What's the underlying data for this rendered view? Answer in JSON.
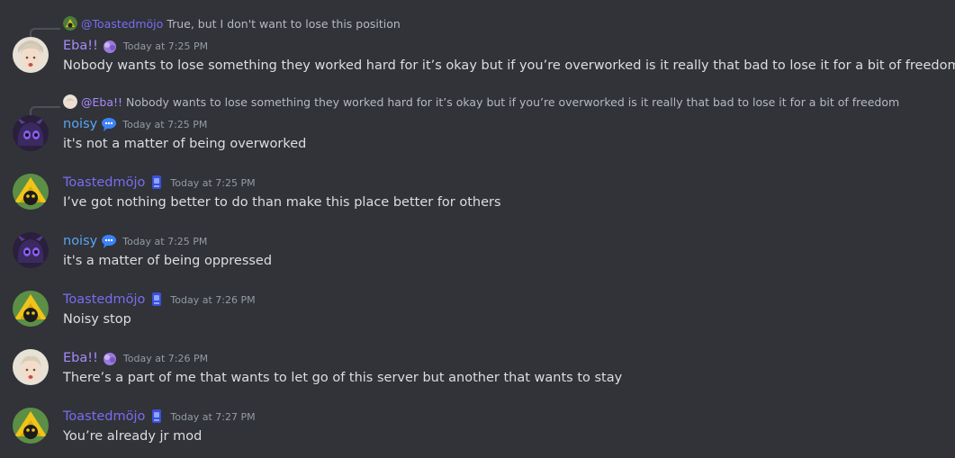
{
  "messages": [
    {
      "reply": {
        "author": "@Toastedmöjo",
        "text": "True, but I don't want to lose this position"
      },
      "author": "Eba!!",
      "time": "Today at 7:25 PM",
      "text": "Nobody wants to lose something they worked hard for it’s okay but if you’re overworked is it really that bad to lose it for a bit of freedom"
    },
    {
      "reply": {
        "author": "@Eba!!",
        "text": "Nobody wants to lose something they worked hard for it’s okay but if you’re overworked is it really that bad to lose it for a bit of freedom"
      },
      "author": "noisy",
      "time": "Today at 7:25 PM",
      "text": "it's not a matter of being overworked"
    },
    {
      "author": "Toastedmöjo",
      "time": "Today at 7:25 PM",
      "text": "I’ve got nothing better to do than make this place better for others"
    },
    {
      "author": "noisy",
      "time": "Today at 7:25 PM",
      "text": "it's a matter of being oppressed"
    },
    {
      "author": "Toastedmöjo",
      "time": "Today at 7:26 PM",
      "text": "Noisy stop"
    },
    {
      "author": "Eba!!",
      "time": "Today at 7:26 PM",
      "text": "There’s a part of me that wants to let go of this server but another that wants to stay"
    },
    {
      "author": "Toastedmöjo",
      "time": "Today at 7:27 PM",
      "text": "You’re already jr mod"
    }
  ],
  "colors": {
    "background": "#313338",
    "eba_name": "#a78bfa",
    "noisy_name": "#5aa4f0",
    "toasted_name": "#7b6cf0",
    "timestamp": "#949ba4",
    "text": "#dbdee1"
  }
}
